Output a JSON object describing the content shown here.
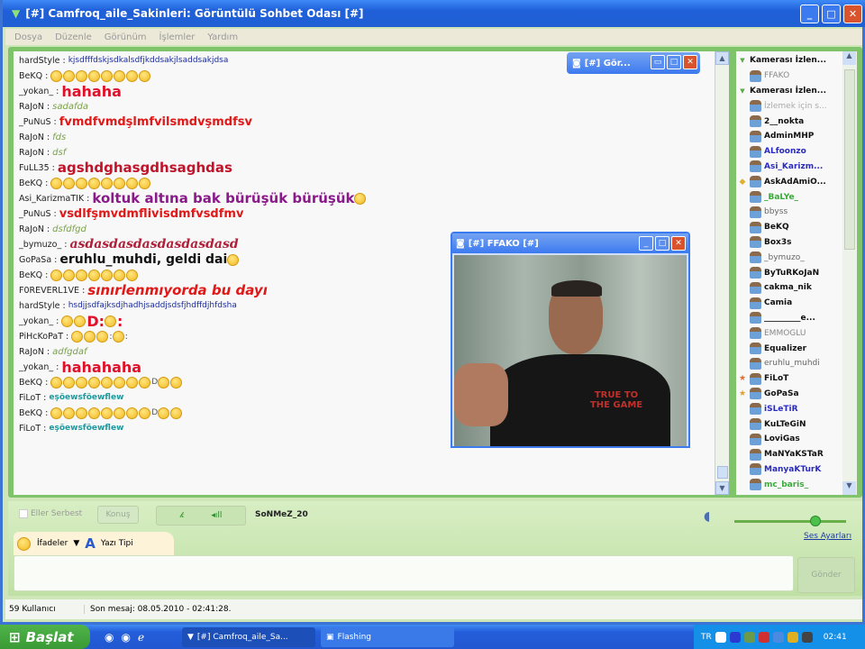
{
  "window": {
    "title": "[#] Camfroq_aile_Sakinleri: Görüntülü Sohbet Odası [#]",
    "buttons": [
      "_",
      "□",
      "✕"
    ]
  },
  "menu": [
    "Dosya",
    "Düzenle",
    "Görünüm",
    "İşlemler",
    "Yardım"
  ],
  "chat": [
    {
      "nick": "hardStyle",
      "parts": [
        {
          "t": "kjsdfffdskjsdkalsdfjkddsakjlsaddsakjdsa",
          "c": "#1c2c9c",
          "s": 9
        }
      ]
    },
    {
      "nick": "BeKQ",
      "parts": [
        {
          "smileys": 8
        }
      ]
    },
    {
      "nick": "_yokan_",
      "parts": [
        {
          "t": "hahaha",
          "c": "#e0102a",
          "s": 16,
          "b": 1
        }
      ]
    },
    {
      "nick": "RaJoN",
      "parts": [
        {
          "t": "sadafda",
          "c": "#7aa04a",
          "s": 10,
          "i": 1
        }
      ]
    },
    {
      "nick": "_PuNuS",
      "parts": [
        {
          "t": "fvmdfvmdşlmfvilsmdvşmdfsv",
          "c": "#e01818",
          "s": 13,
          "b": 1
        }
      ]
    },
    {
      "nick": "RaJoN",
      "parts": [
        {
          "t": "fds",
          "c": "#7aa04a",
          "s": 10,
          "i": 1
        }
      ]
    },
    {
      "nick": "RaJoN",
      "parts": [
        {
          "t": "dsf",
          "c": "#7aa04a",
          "s": 10,
          "i": 1
        }
      ]
    },
    {
      "nick": "FuLL35",
      "parts": [
        {
          "t": "agshdghasgdhsaghdas",
          "c": "#c0142a",
          "s": 15,
          "b": 1
        }
      ]
    },
    {
      "nick": "BeKQ",
      "parts": [
        {
          "smileys": 8
        }
      ]
    },
    {
      "nick": "Asi_KarizmaTIK",
      "parts": [
        {
          "t": "koltuk altına bak bürüşük bürüşük",
          "c": "#8a1a8a",
          "s": 15,
          "b": 1
        },
        {
          "smileys": 1
        }
      ]
    },
    {
      "nick": "_PuNuS",
      "parts": [
        {
          "t": "vsdlfşmvdmflivisdmfvsdfmv",
          "c": "#e01818",
          "s": 13,
          "b": 1
        }
      ]
    },
    {
      "nick": "RaJoN",
      "parts": [
        {
          "t": "dsfdfgd",
          "c": "#7aa04a",
          "s": 10,
          "i": 1
        }
      ]
    },
    {
      "nick": "_bymuzo_",
      "parts": [
        {
          "t": "asdasdasdasdasdasdasd",
          "c": "#b0203a",
          "s": 14,
          "b": 1,
          "i": 1,
          "serif": 1
        }
      ]
    },
    {
      "nick": "GoPaSa",
      "parts": [
        {
          "t": "eruhlu_muhdi, geldi dai",
          "c": "#111",
          "s": 14,
          "b": 1
        },
        {
          "smileys": 1
        }
      ]
    },
    {
      "nick": "BeKQ",
      "parts": [
        {
          "smileys": 7
        }
      ]
    },
    {
      "nick": "F0REVERL1VE",
      "parts": [
        {
          "t": "sınırlenmıyorda bu dayı",
          "c": "#e01818",
          "s": 15,
          "b": 1,
          "i": 1
        }
      ]
    },
    {
      "nick": "hardStyle",
      "parts": [
        {
          "t": "hsdjjsdfajksdjhadhjsaddjsdsfjhdffdjhfdsha",
          "c": "#1c2c9c",
          "s": 9
        }
      ]
    },
    {
      "nick": "_yokan_",
      "parts": [
        {
          "smileys": 2
        },
        {
          "t": "D:",
          "c": "#e0102a",
          "s": 16,
          "b": 1
        },
        {
          "smileys": 1
        },
        {
          "t": ":",
          "c": "#e0102a",
          "s": 16,
          "b": 1
        }
      ]
    },
    {
      "nick": "PiHcKoPaT",
      "parts": [
        {
          "smileys": 3
        },
        {
          "t": ":",
          "c": "#555",
          "s": 10
        },
        {
          "smileys": 1
        },
        {
          "t": ":",
          "c": "#555",
          "s": 10
        }
      ]
    },
    {
      "nick": "RaJoN",
      "parts": [
        {
          "t": "adfgdaf",
          "c": "#7aa04a",
          "s": 10,
          "i": 1
        }
      ]
    },
    {
      "nick": "_yokan_",
      "parts": [
        {
          "t": "hahahaha",
          "c": "#e0102a",
          "s": 16,
          "b": 1
        }
      ]
    },
    {
      "nick": "BeKQ",
      "parts": [
        {
          "smileys": 8
        },
        {
          "t": "D",
          "c": "#555",
          "s": 9
        },
        {
          "smileys": 2
        }
      ]
    },
    {
      "nick": "FiLoT",
      "parts": [
        {
          "t": "eşöewsföewflew",
          "c": "#1a9aa0",
          "s": 9,
          "b": 1
        }
      ]
    },
    {
      "nick": "BeKQ",
      "parts": [
        {
          "smileys": 8
        },
        {
          "t": "D",
          "c": "#555",
          "s": 9
        },
        {
          "smileys": 2
        }
      ]
    },
    {
      "nick": "FiLoT",
      "parts": [
        {
          "t": "eşöewsföewflew",
          "c": "#1a9aa0",
          "s": 9,
          "b": 1
        }
      ]
    }
  ],
  "users": [
    {
      "name": "Kamerası İzlen...",
      "header": 1
    },
    {
      "name": "FFAKO",
      "c": "#888",
      "w": "normal"
    },
    {
      "name": "Kamerası İzlen...",
      "header": 1
    },
    {
      "name": "İzlemek için s...",
      "c": "#aaa",
      "w": "normal"
    },
    {
      "name": "2__nokta",
      "c": "#111"
    },
    {
      "name": "AdminMHP",
      "c": "#111"
    },
    {
      "name": "ALfoonzo",
      "c": "#2a2ac0"
    },
    {
      "name": "Asi_Karizm...",
      "c": "#2a2ac0"
    },
    {
      "name": "AskAdAmiO...",
      "c": "#111",
      "mark": "◆",
      "mc": "#e0b030"
    },
    {
      "name": "_BaLYe_",
      "c": "#3aaa3a"
    },
    {
      "name": "bbyss",
      "c": "#666",
      "w": "normal"
    },
    {
      "name": "BeKQ",
      "c": "#111"
    },
    {
      "name": "Box3s",
      "c": "#111"
    },
    {
      "name": "_bymuzo_",
      "c": "#666",
      "w": "normal"
    },
    {
      "name": "ByTuRKoJaN",
      "c": "#111"
    },
    {
      "name": "cakma_nik",
      "c": "#111"
    },
    {
      "name": "Camia",
      "c": "#111"
    },
    {
      "name": "_________e...",
      "c": "#111"
    },
    {
      "name": "EMMOGLU",
      "c": "#888",
      "w": "normal"
    },
    {
      "name": "Equalizer",
      "c": "#111"
    },
    {
      "name": "eruhlu_muhdi",
      "c": "#666",
      "w": "normal"
    },
    {
      "name": "FiLoT",
      "c": "#111",
      "mark": "★",
      "mc": "#e07030"
    },
    {
      "name": "GoPaSa",
      "c": "#111",
      "mark": "★",
      "mc": "#e0a030"
    },
    {
      "name": "iSLeTiR",
      "c": "#2a2ac0"
    },
    {
      "name": "KuLTeGiN",
      "c": "#111"
    },
    {
      "name": "LoviGas",
      "c": "#111"
    },
    {
      "name": "MaNYaKSTaR",
      "c": "#111"
    },
    {
      "name": "ManyaKTurK",
      "c": "#2a2ac0"
    },
    {
      "name": "mc_baris_",
      "c": "#3aaa3a"
    }
  ],
  "video": {
    "title": "[#] FFAKO [#]",
    "shirt_text": "TRUE TO THE GAME"
  },
  "mini_video": {
    "title": "[#] Gör..."
  },
  "controls": {
    "hands_free": "Eller Serbest",
    "talk": "Konuş",
    "speaker": "SoNMeZ_20",
    "sound_settings": "Ses Ayarları",
    "emotes": "İfadeler",
    "font": "Yazı Tipi",
    "send": "Gönder",
    "volume_percent": 75
  },
  "status": {
    "users": "59 Kullanıcı",
    "last_message": "Son mesaj: 08.05.2010 - 02:41:28."
  },
  "taskbar": {
    "start": "Başlat",
    "tasks": [
      "[#] Camfroq_aile_Sa...",
      "Flashing"
    ],
    "lang": "TR",
    "clock": "02:41"
  }
}
